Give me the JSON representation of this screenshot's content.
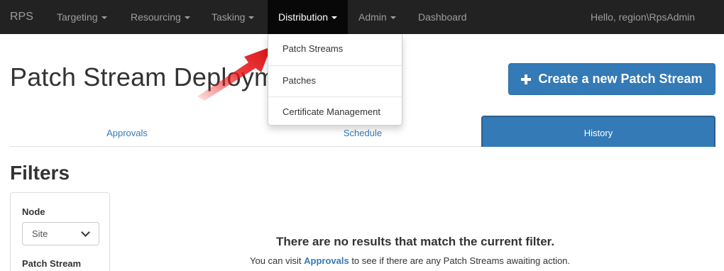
{
  "navbar": {
    "brand": "RPS",
    "items": [
      {
        "label": "Targeting"
      },
      {
        "label": "Resourcing"
      },
      {
        "label": "Tasking"
      },
      {
        "label": "Distribution"
      },
      {
        "label": "Admin"
      },
      {
        "label": "Dashboard"
      }
    ],
    "greeting": "Hello, region\\RpsAdmin"
  },
  "dropdown": {
    "items": [
      {
        "label": "Patch Streams"
      },
      {
        "label": "Patches"
      },
      {
        "label": "Certificate Management"
      }
    ]
  },
  "page": {
    "title": "Patch Stream Deployments",
    "create_button": "Create a new Patch Stream"
  },
  "tabs": [
    {
      "label": "Approvals"
    },
    {
      "label": "Schedule"
    },
    {
      "label": "History",
      "active": true
    }
  ],
  "filters": {
    "title": "Filters",
    "node_label": "Node",
    "node_value": "Site",
    "patch_stream_label": "Patch Stream"
  },
  "empty_state": {
    "title": "There are no results that match the current filter.",
    "prefix": "You can visit ",
    "link": "Approvals",
    "suffix": " to see if there are any Patch Streams awaiting action."
  },
  "colors": {
    "navbar_bg": "#222222",
    "primary": "#337ab7",
    "annotation_arrow": "#e8191c"
  },
  "icons": {
    "create": "plus-icon",
    "select": "chevron-down-icon",
    "annotation": "red-arrow-icon"
  }
}
